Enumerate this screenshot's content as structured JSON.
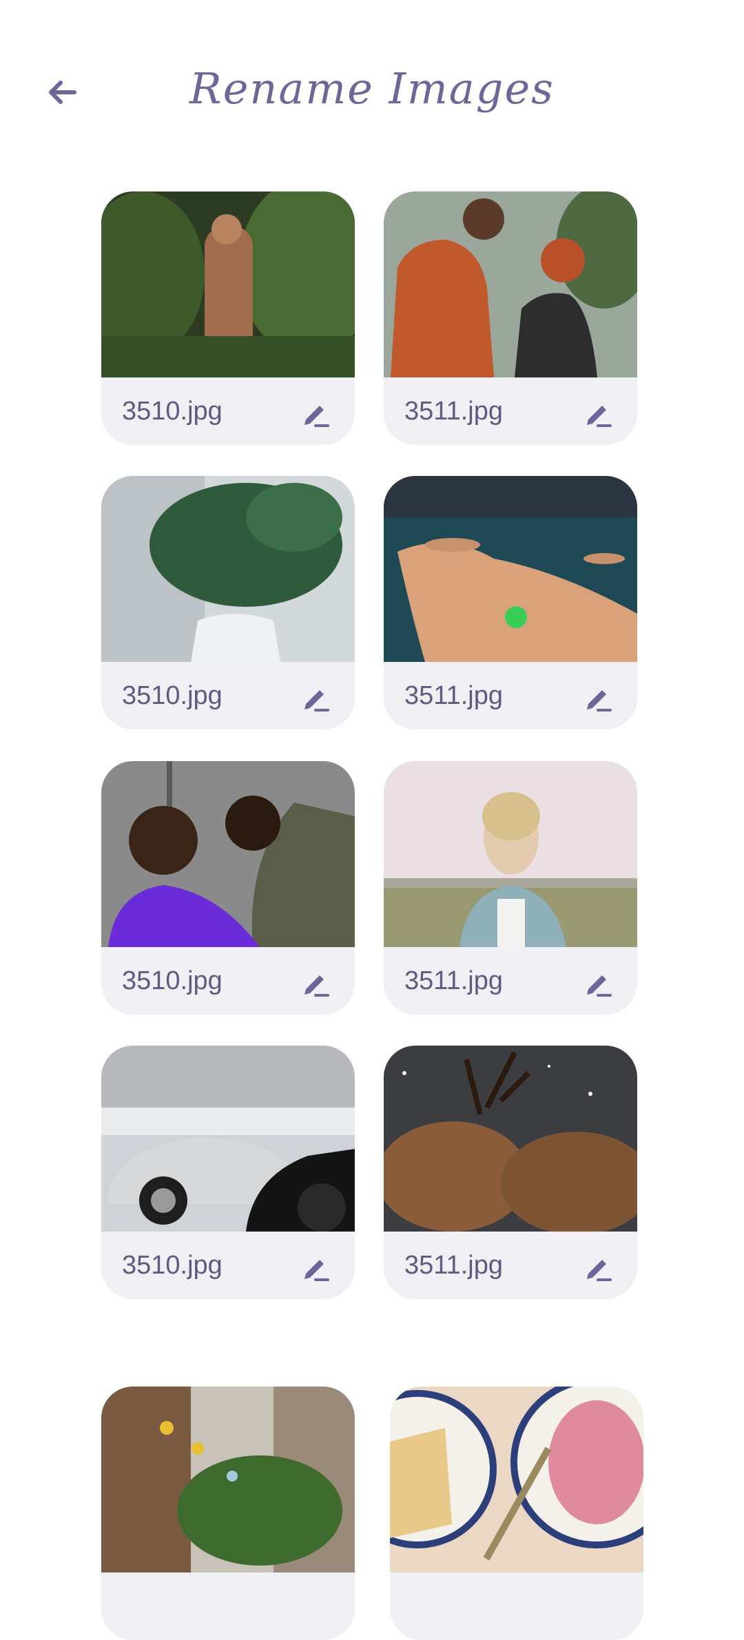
{
  "header": {
    "title": "Rename Images",
    "back_icon": "arrow-left-icon"
  },
  "accent_color": "#6e6699",
  "images": [
    {
      "filename": "3510.jpg",
      "subject": "man in tropical foliage"
    },
    {
      "filename": "3511.jpg",
      "subject": "couple in winter jackets"
    },
    {
      "filename": "3510.jpg",
      "subject": "plant in white vase"
    },
    {
      "filename": "3511.jpg",
      "subject": "aerial coastline rocks"
    },
    {
      "filename": "3510.jpg",
      "subject": "laughing couple"
    },
    {
      "filename": "3511.jpg",
      "subject": "woman in field"
    },
    {
      "filename": "3510.jpg",
      "subject": "silver sports car"
    },
    {
      "filename": "3511.jpg",
      "subject": "two deer in snow"
    },
    {
      "filename": "",
      "subject": "city street with trees"
    },
    {
      "filename": "",
      "subject": "cake on decorative plates"
    }
  ]
}
